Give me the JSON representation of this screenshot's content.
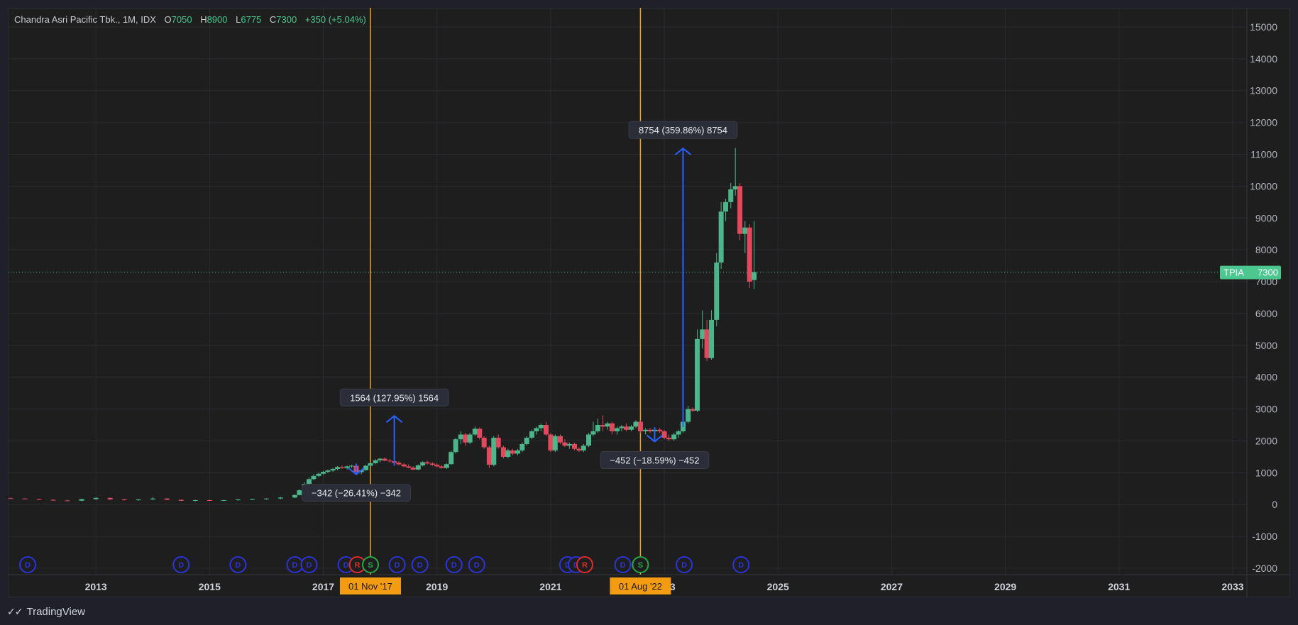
{
  "header": {
    "symbol_name": "Chandra Asri Pacific Tbk., 1M, IDX",
    "open_label": "O",
    "open": "7050",
    "high_label": "H",
    "high": "8900",
    "low_label": "L",
    "low": "6775",
    "close_label": "C",
    "close": "7300",
    "change": "+350 (+5.04%)"
  },
  "footer": {
    "brand": "TradingView"
  },
  "price_tag": {
    "ticker": "TPIA",
    "value": "7300"
  },
  "colors": {
    "up": "#4cb58a",
    "down": "#e2495d",
    "vline": "#f2a11a",
    "measure": "#2962ff",
    "grid": "#2a2b30",
    "axis_text": "#b2b5be",
    "price_tag": "#4cc790"
  },
  "chart_data": {
    "type": "candlestick",
    "title": "Chandra Asri Pacific Tbk., 1M, IDX",
    "x_axis": {
      "ticks": [
        "2013",
        "2015",
        "2017",
        "2019",
        "2021",
        "2023",
        "2025",
        "2027",
        "2029",
        "2031",
        "2033"
      ],
      "range": [
        2011.45,
        2033.25
      ]
    },
    "y_axis": {
      "ticks": [
        "-2000",
        "-1000",
        "0",
        "1000",
        "2000",
        "3000",
        "4000",
        "5000",
        "6000",
        "7000",
        "8000",
        "9000",
        "10000",
        "11000",
        "12000",
        "13000",
        "14000",
        "15000"
      ],
      "range": [
        -2200,
        15600
      ]
    },
    "grid": true,
    "current_price": 7300,
    "candles": [
      {
        "t": 2011.5,
        "o": 200,
        "h": 220,
        "l": 180,
        "c": 190
      },
      {
        "t": 2011.75,
        "o": 190,
        "h": 200,
        "l": 160,
        "c": 170
      },
      {
        "t": 2012.0,
        "o": 170,
        "h": 180,
        "l": 140,
        "c": 150
      },
      {
        "t": 2012.25,
        "o": 150,
        "h": 160,
        "l": 120,
        "c": 130
      },
      {
        "t": 2012.5,
        "o": 130,
        "h": 150,
        "l": 110,
        "c": 120
      },
      {
        "t": 2012.75,
        "o": 120,
        "h": 180,
        "l": 110,
        "c": 170
      },
      {
        "t": 2013.0,
        "o": 170,
        "h": 230,
        "l": 150,
        "c": 210
      },
      {
        "t": 2013.25,
        "o": 210,
        "h": 220,
        "l": 150,
        "c": 160
      },
      {
        "t": 2013.5,
        "o": 160,
        "h": 180,
        "l": 130,
        "c": 140
      },
      {
        "t": 2013.75,
        "o": 140,
        "h": 170,
        "l": 120,
        "c": 160
      },
      {
        "t": 2014.0,
        "o": 160,
        "h": 230,
        "l": 150,
        "c": 190
      },
      {
        "t": 2014.25,
        "o": 190,
        "h": 200,
        "l": 140,
        "c": 150
      },
      {
        "t": 2014.5,
        "o": 150,
        "h": 160,
        "l": 110,
        "c": 120
      },
      {
        "t": 2014.75,
        "o": 120,
        "h": 150,
        "l": 100,
        "c": 140
      },
      {
        "t": 2015.0,
        "o": 140,
        "h": 160,
        "l": 120,
        "c": 130
      },
      {
        "t": 2015.25,
        "o": 130,
        "h": 150,
        "l": 110,
        "c": 140
      },
      {
        "t": 2015.5,
        "o": 140,
        "h": 170,
        "l": 120,
        "c": 160
      },
      {
        "t": 2015.75,
        "o": 160,
        "h": 180,
        "l": 140,
        "c": 170
      },
      {
        "t": 2016.0,
        "o": 170,
        "h": 200,
        "l": 150,
        "c": 190
      },
      {
        "t": 2016.25,
        "o": 190,
        "h": 240,
        "l": 170,
        "c": 220
      },
      {
        "t": 2016.5,
        "o": 220,
        "h": 320,
        "l": 200,
        "c": 300
      },
      {
        "t": 2016.58,
        "o": 300,
        "h": 480,
        "l": 280,
        "c": 450
      },
      {
        "t": 2016.67,
        "o": 450,
        "h": 700,
        "l": 420,
        "c": 650
      },
      {
        "t": 2016.75,
        "o": 650,
        "h": 850,
        "l": 600,
        "c": 800
      },
      {
        "t": 2016.83,
        "o": 800,
        "h": 950,
        "l": 760,
        "c": 900
      },
      {
        "t": 2016.92,
        "o": 900,
        "h": 1000,
        "l": 860,
        "c": 970
      },
      {
        "t": 2017.0,
        "o": 970,
        "h": 1060,
        "l": 930,
        "c": 1030
      },
      {
        "t": 2017.08,
        "o": 1030,
        "h": 1100,
        "l": 990,
        "c": 1070
      },
      {
        "t": 2017.17,
        "o": 1070,
        "h": 1150,
        "l": 1030,
        "c": 1120
      },
      {
        "t": 2017.25,
        "o": 1120,
        "h": 1210,
        "l": 1080,
        "c": 1180
      },
      {
        "t": 2017.33,
        "o": 1180,
        "h": 1230,
        "l": 1120,
        "c": 1150
      },
      {
        "t": 2017.42,
        "o": 1150,
        "h": 1220,
        "l": 1100,
        "c": 1200
      },
      {
        "t": 2017.5,
        "o": 1200,
        "h": 1250,
        "l": 1150,
        "c": 1220
      },
      {
        "t": 2017.58,
        "o": 1220,
        "h": 1240,
        "l": 1000,
        "c": 1020
      },
      {
        "t": 2017.67,
        "o": 1020,
        "h": 1100,
        "l": 950,
        "c": 1080
      },
      {
        "t": 2017.75,
        "o": 1080,
        "h": 1250,
        "l": 1060,
        "c": 1220
      },
      {
        "t": 2017.83,
        "o": 1220,
        "h": 1330,
        "l": 1190,
        "c": 1300
      },
      {
        "t": 2017.92,
        "o": 1300,
        "h": 1420,
        "l": 1270,
        "c": 1390
      },
      {
        "t": 2018.0,
        "o": 1390,
        "h": 1470,
        "l": 1330,
        "c": 1440
      },
      {
        "t": 2018.08,
        "o": 1440,
        "h": 1480,
        "l": 1360,
        "c": 1380
      },
      {
        "t": 2018.17,
        "o": 1380,
        "h": 1430,
        "l": 1320,
        "c": 1360
      },
      {
        "t": 2018.25,
        "o": 1360,
        "h": 1400,
        "l": 1290,
        "c": 1310
      },
      {
        "t": 2018.33,
        "o": 1310,
        "h": 1360,
        "l": 1240,
        "c": 1260
      },
      {
        "t": 2018.42,
        "o": 1260,
        "h": 1310,
        "l": 1180,
        "c": 1200
      },
      {
        "t": 2018.5,
        "o": 1200,
        "h": 1260,
        "l": 1140,
        "c": 1160
      },
      {
        "t": 2018.58,
        "o": 1160,
        "h": 1200,
        "l": 1080,
        "c": 1100
      },
      {
        "t": 2018.67,
        "o": 1100,
        "h": 1260,
        "l": 1080,
        "c": 1230
      },
      {
        "t": 2018.75,
        "o": 1230,
        "h": 1360,
        "l": 1200,
        "c": 1330
      },
      {
        "t": 2018.83,
        "o": 1330,
        "h": 1380,
        "l": 1260,
        "c": 1290
      },
      {
        "t": 2018.92,
        "o": 1290,
        "h": 1330,
        "l": 1220,
        "c": 1250
      },
      {
        "t": 2019.0,
        "o": 1250,
        "h": 1300,
        "l": 1170,
        "c": 1200
      },
      {
        "t": 2019.08,
        "o": 1200,
        "h": 1250,
        "l": 1130,
        "c": 1150
      },
      {
        "t": 2019.17,
        "o": 1150,
        "h": 1300,
        "l": 1120,
        "c": 1270
      },
      {
        "t": 2019.25,
        "o": 1270,
        "h": 1700,
        "l": 1250,
        "c": 1650
      },
      {
        "t": 2019.33,
        "o": 1650,
        "h": 2100,
        "l": 1600,
        "c": 2050
      },
      {
        "t": 2019.42,
        "o": 2050,
        "h": 2300,
        "l": 1900,
        "c": 2200
      },
      {
        "t": 2019.5,
        "o": 2200,
        "h": 2250,
        "l": 1850,
        "c": 1950
      },
      {
        "t": 2019.58,
        "o": 1950,
        "h": 2250,
        "l": 1900,
        "c": 2200
      },
      {
        "t": 2019.67,
        "o": 2200,
        "h": 2450,
        "l": 2150,
        "c": 2380
      },
      {
        "t": 2019.75,
        "o": 2380,
        "h": 2420,
        "l": 2050,
        "c": 2100
      },
      {
        "t": 2019.83,
        "o": 2100,
        "h": 2150,
        "l": 1750,
        "c": 1800
      },
      {
        "t": 2019.92,
        "o": 1800,
        "h": 1850,
        "l": 1150,
        "c": 1250
      },
      {
        "t": 2020.0,
        "o": 1250,
        "h": 2150,
        "l": 1200,
        "c": 2100
      },
      {
        "t": 2020.08,
        "o": 2100,
        "h": 2200,
        "l": 1750,
        "c": 1800
      },
      {
        "t": 2020.17,
        "o": 1800,
        "h": 1850,
        "l": 1450,
        "c": 1500
      },
      {
        "t": 2020.25,
        "o": 1500,
        "h": 1750,
        "l": 1450,
        "c": 1700
      },
      {
        "t": 2020.33,
        "o": 1700,
        "h": 1750,
        "l": 1550,
        "c": 1600
      },
      {
        "t": 2020.42,
        "o": 1600,
        "h": 1750,
        "l": 1550,
        "c": 1700
      },
      {
        "t": 2020.5,
        "o": 1700,
        "h": 1950,
        "l": 1650,
        "c": 1900
      },
      {
        "t": 2020.58,
        "o": 1900,
        "h": 2150,
        "l": 1850,
        "c": 2100
      },
      {
        "t": 2020.67,
        "o": 2100,
        "h": 2350,
        "l": 2050,
        "c": 2300
      },
      {
        "t": 2020.75,
        "o": 2300,
        "h": 2450,
        "l": 2200,
        "c": 2400
      },
      {
        "t": 2020.83,
        "o": 2400,
        "h": 2550,
        "l": 2300,
        "c": 2500
      },
      {
        "t": 2020.92,
        "o": 2500,
        "h": 2600,
        "l": 2150,
        "c": 2200
      },
      {
        "t": 2021.0,
        "o": 2200,
        "h": 2250,
        "l": 1650,
        "c": 1700
      },
      {
        "t": 2021.08,
        "o": 1700,
        "h": 2200,
        "l": 1650,
        "c": 2150
      },
      {
        "t": 2021.17,
        "o": 2150,
        "h": 2200,
        "l": 1900,
        "c": 1950
      },
      {
        "t": 2021.25,
        "o": 1950,
        "h": 2050,
        "l": 1800,
        "c": 1850
      },
      {
        "t": 2021.33,
        "o": 1850,
        "h": 1950,
        "l": 1750,
        "c": 1900
      },
      {
        "t": 2021.42,
        "o": 1900,
        "h": 1950,
        "l": 1700,
        "c": 1750
      },
      {
        "t": 2021.5,
        "o": 1750,
        "h": 1800,
        "l": 1650,
        "c": 1700
      },
      {
        "t": 2021.58,
        "o": 1700,
        "h": 1900,
        "l": 1650,
        "c": 1850
      },
      {
        "t": 2021.67,
        "o": 1850,
        "h": 2250,
        "l": 1800,
        "c": 2200
      },
      {
        "t": 2021.75,
        "o": 2200,
        "h": 2600,
        "l": 2150,
        "c": 2300
      },
      {
        "t": 2021.83,
        "o": 2300,
        "h": 2700,
        "l": 2250,
        "c": 2500
      },
      {
        "t": 2021.92,
        "o": 2500,
        "h": 2800,
        "l": 2300,
        "c": 2450
      },
      {
        "t": 2022.0,
        "o": 2450,
        "h": 2600,
        "l": 2350,
        "c": 2550
      },
      {
        "t": 2022.08,
        "o": 2550,
        "h": 2600,
        "l": 2200,
        "c": 2300
      },
      {
        "t": 2022.17,
        "o": 2300,
        "h": 2450,
        "l": 2200,
        "c": 2400
      },
      {
        "t": 2022.25,
        "o": 2400,
        "h": 2500,
        "l": 2300,
        "c": 2450
      },
      {
        "t": 2022.33,
        "o": 2450,
        "h": 2550,
        "l": 2300,
        "c": 2350
      },
      {
        "t": 2022.42,
        "o": 2350,
        "h": 2500,
        "l": 2300,
        "c": 2450
      },
      {
        "t": 2022.5,
        "o": 2450,
        "h": 2650,
        "l": 2400,
        "c": 2600
      },
      {
        "t": 2022.58,
        "o": 2600,
        "h": 2650,
        "l": 2250,
        "c": 2300
      },
      {
        "t": 2022.67,
        "o": 2300,
        "h": 2400,
        "l": 2200,
        "c": 2350
      },
      {
        "t": 2022.75,
        "o": 2350,
        "h": 2400,
        "l": 2250,
        "c": 2300
      },
      {
        "t": 2022.83,
        "o": 2300,
        "h": 2400,
        "l": 2200,
        "c": 2350
      },
      {
        "t": 2022.92,
        "o": 2350,
        "h": 2400,
        "l": 2250,
        "c": 2300
      },
      {
        "t": 2023.0,
        "o": 2300,
        "h": 2350,
        "l": 2050,
        "c": 2100
      },
      {
        "t": 2023.08,
        "o": 2100,
        "h": 2200,
        "l": 2000,
        "c": 2050
      },
      {
        "t": 2023.17,
        "o": 2050,
        "h": 2250,
        "l": 2000,
        "c": 2200
      },
      {
        "t": 2023.25,
        "o": 2200,
        "h": 2350,
        "l": 2100,
        "c": 2300
      },
      {
        "t": 2023.33,
        "o": 2300,
        "h": 2650,
        "l": 2250,
        "c": 2600
      },
      {
        "t": 2023.42,
        "o": 2600,
        "h": 3100,
        "l": 2550,
        "c": 3000
      },
      {
        "t": 2023.5,
        "o": 3000,
        "h": 3050,
        "l": 2900,
        "c": 2950
      },
      {
        "t": 2023.58,
        "o": 2950,
        "h": 5500,
        "l": 2900,
        "c": 5200
      },
      {
        "t": 2023.67,
        "o": 5200,
        "h": 6100,
        "l": 4900,
        "c": 5500
      },
      {
        "t": 2023.75,
        "o": 5500,
        "h": 5800,
        "l": 4500,
        "c": 4600
      },
      {
        "t": 2023.83,
        "o": 4600,
        "h": 6100,
        "l": 4550,
        "c": 5800
      },
      {
        "t": 2023.92,
        "o": 5800,
        "h": 7900,
        "l": 5600,
        "c": 7600
      },
      {
        "t": 2024.0,
        "o": 7600,
        "h": 9500,
        "l": 7400,
        "c": 9200
      },
      {
        "t": 2024.08,
        "o": 9200,
        "h": 9600,
        "l": 8900,
        "c": 9500
      },
      {
        "t": 2024.17,
        "o": 9500,
        "h": 10100,
        "l": 9300,
        "c": 9900
      },
      {
        "t": 2024.25,
        "o": 9900,
        "h": 11200,
        "l": 9700,
        "c": 10000
      },
      {
        "t": 2024.33,
        "o": 10000,
        "h": 10100,
        "l": 8300,
        "c": 8500
      },
      {
        "t": 2024.42,
        "o": 8500,
        "h": 8900,
        "l": 7900,
        "c": 8700
      },
      {
        "t": 2024.5,
        "o": 8700,
        "h": 8800,
        "l": 6800,
        "c": 7000
      },
      {
        "t": 2024.58,
        "o": 7050,
        "h": 8900,
        "l": 6775,
        "c": 7300
      }
    ],
    "vertical_lines": [
      {
        "t": 2017.83,
        "label": "01 Nov '17"
      },
      {
        "t": 2022.58,
        "label": "01 Aug '22"
      }
    ],
    "measures": [
      {
        "t": 2018.25,
        "from": 1220,
        "to": 2784,
        "label": "1564 (127.95%) 1564"
      },
      {
        "t": 2017.58,
        "from": 1290,
        "to": 948,
        "label": "−342 (−26.41%) −342"
      },
      {
        "t": 2022.83,
        "from": 2430,
        "to": 1978,
        "label": "−452 (−18.59%) −452"
      },
      {
        "t": 2023.33,
        "from": 2432,
        "to": 11186,
        "label": "8754 (359.86%) 8754"
      }
    ],
    "events": [
      {
        "t": 2011.8,
        "kind": "D"
      },
      {
        "t": 2014.5,
        "kind": "D"
      },
      {
        "t": 2015.5,
        "kind": "D"
      },
      {
        "t": 2016.5,
        "kind": "D"
      },
      {
        "t": 2016.75,
        "kind": "D"
      },
      {
        "t": 2017.4,
        "kind": "D"
      },
      {
        "t": 2017.6,
        "kind": "R"
      },
      {
        "t": 2017.83,
        "kind": "S"
      },
      {
        "t": 2018.3,
        "kind": "D"
      },
      {
        "t": 2018.7,
        "kind": "D"
      },
      {
        "t": 2019.3,
        "kind": "D"
      },
      {
        "t": 2019.7,
        "kind": "D"
      },
      {
        "t": 2021.3,
        "kind": "D"
      },
      {
        "t": 2021.45,
        "kind": "D"
      },
      {
        "t": 2021.6,
        "kind": "R"
      },
      {
        "t": 2022.27,
        "kind": "D"
      },
      {
        "t": 2022.58,
        "kind": "S"
      },
      {
        "t": 2023.35,
        "kind": "D"
      },
      {
        "t": 2024.35,
        "kind": "D"
      }
    ]
  }
}
